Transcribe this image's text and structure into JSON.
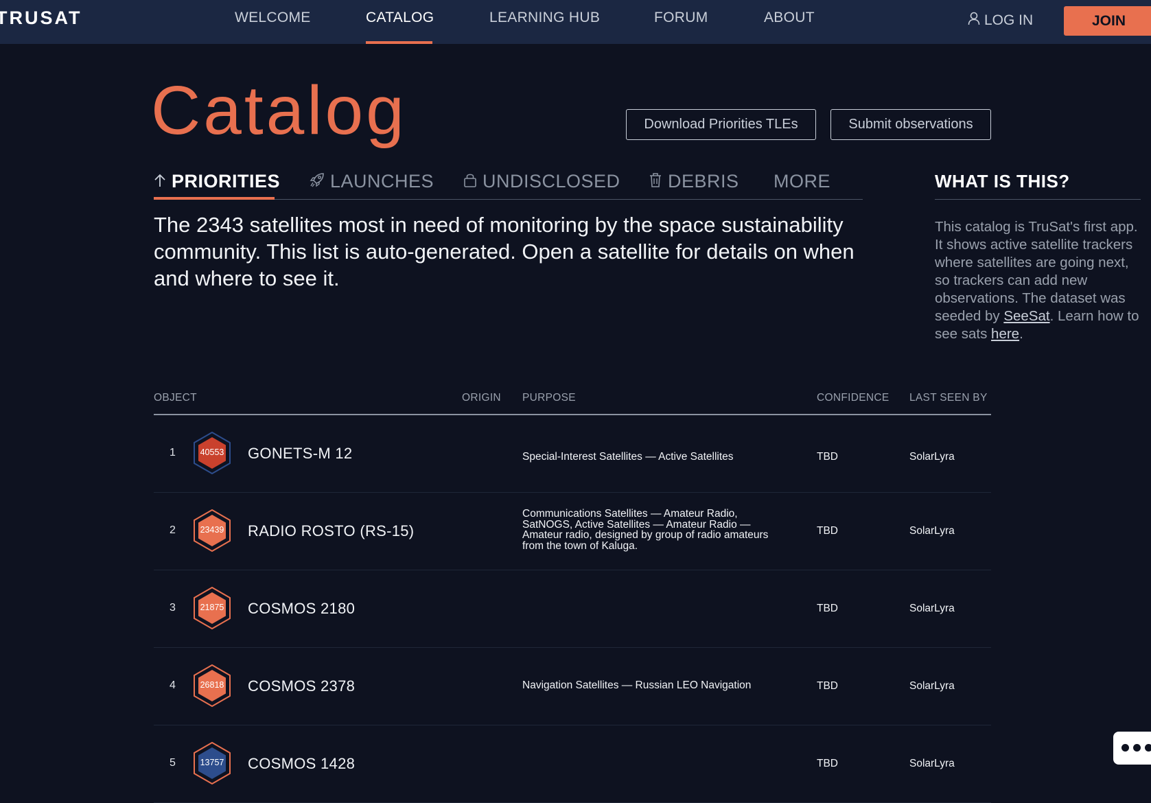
{
  "nav": {
    "logo": "TRUSAT",
    "items": [
      "WELCOME",
      "CATALOG",
      "LEARNING HUB",
      "FORUM",
      "ABOUT"
    ],
    "active": "CATALOG",
    "login_label": "LOG IN",
    "join_label": "JOIN"
  },
  "header": {
    "title": "Catalog",
    "download_button": "Download Priorities TLEs",
    "submit_button": "Submit observations"
  },
  "tabs": [
    {
      "label": "PRIORITIES",
      "icon": "arrow-up-icon",
      "active": true
    },
    {
      "label": "LAUNCHES",
      "icon": "rocket-icon",
      "active": false
    },
    {
      "label": "UNDISCLOSED",
      "icon": "lock-icon",
      "active": false
    },
    {
      "label": "DEBRIS",
      "icon": "trash-icon",
      "active": false
    },
    {
      "label": "MORE",
      "icon": "",
      "active": false
    }
  ],
  "description": "The 2343 satellites most in need of monitoring by the space sustainability community. This list is auto-generated. Open a satellite for details on when and where to see it.",
  "sidebar": {
    "title": "WHAT IS THIS?",
    "text_1": "This catalog is TruSat's first app. It shows active satellite trackers where satellites are going next, so trackers can add new observations. The dataset was seeded by ",
    "link_1": "SeeSat",
    "text_2": ". Learn how to see sats ",
    "link_2": "here",
    "text_3": "."
  },
  "table": {
    "columns": [
      "OBJECT",
      "ORIGIN",
      "PURPOSE",
      "CONFIDENCE",
      "LAST SEEN BY"
    ],
    "rows": [
      {
        "rank": "1",
        "norad": "40553",
        "name": "GONETS-M 12",
        "origin": "",
        "purpose": "Special-Interest Satellites — Active Satellites",
        "confidence": "TBD",
        "last_seen_by": "SolarLyra",
        "badge_fill": "#c9412d",
        "badge_border": "#2d4d8c"
      },
      {
        "rank": "2",
        "norad": "23439",
        "name": "RADIO ROSTO (RS-15)",
        "origin": "",
        "purpose": "Communications Satellites — Amateur Radio, SatNOGS, Active Satellites — Amateur Radio — Amateur radio, designed by group of radio amateurs from the town of Kaluga.",
        "confidence": "TBD",
        "last_seen_by": "SolarLyra",
        "badge_fill": "#e8704f",
        "badge_border": "#e8704f"
      },
      {
        "rank": "3",
        "norad": "21875",
        "name": "COSMOS 2180",
        "origin": "",
        "purpose": "",
        "confidence": "TBD",
        "last_seen_by": "SolarLyra",
        "badge_fill": "#e8704f",
        "badge_border": "#e8704f"
      },
      {
        "rank": "4",
        "norad": "26818",
        "name": "COSMOS 2378",
        "origin": "",
        "purpose": "Navigation Satellites — Russian LEO Navigation",
        "confidence": "TBD",
        "last_seen_by": "SolarLyra",
        "badge_fill": "#e8704f",
        "badge_border": "#e8704f"
      },
      {
        "rank": "5",
        "norad": "13757",
        "name": "COSMOS 1428",
        "origin": "",
        "purpose": "",
        "confidence": "TBD",
        "last_seen_by": "SolarLyra",
        "badge_fill": "#2d4d8c",
        "badge_border": "#e8704f"
      }
    ]
  },
  "colors": {
    "accent": "#e8704f",
    "nav_bg": "#1b2742",
    "page_bg": "#0e1220"
  }
}
